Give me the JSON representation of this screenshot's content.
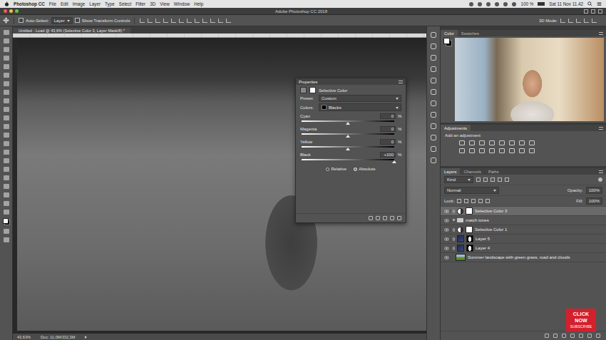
{
  "menubar": {
    "app": "Photoshop CC",
    "items": [
      "File",
      "Edit",
      "Image",
      "Layer",
      "Type",
      "Select",
      "Filter",
      "3D",
      "View",
      "Window",
      "Help"
    ],
    "battery": "100 %",
    "clock": "Sat 11 Nov 11.42"
  },
  "window": {
    "title": "Adobe Photoshop CC 2018"
  },
  "options_bar": {
    "auto_select_label": "Auto-Select:",
    "auto_select_checked": false,
    "auto_select_value": "Layer",
    "transform_label": "Show Transform Controls",
    "transform_checked": false,
    "mode_label": "3D Mode:"
  },
  "document_tab": {
    "title": "Untitled - Load @ 43,6% (Selective Color 3, Layer Mask/8) *"
  },
  "properties": {
    "title": "Properties",
    "adjustment": "Selective Color",
    "preset_label": "Preset:",
    "preset": "Custom",
    "colors_label": "Colors:",
    "colors": "Blacks",
    "sliders": [
      {
        "name": "Cyan",
        "value": "0",
        "unit": "%",
        "level": 0.5
      },
      {
        "name": "Magenta",
        "value": "0",
        "unit": "%",
        "level": 0.5
      },
      {
        "name": "Yellow",
        "value": "0",
        "unit": "%",
        "level": 0.5
      },
      {
        "name": "Black",
        "value": "+100",
        "unit": "%",
        "level": 1
      }
    ],
    "method": [
      {
        "label": "Relative",
        "selected": false
      },
      {
        "label": "Absolute",
        "selected": true
      }
    ]
  },
  "status_bar": {
    "zoom": "43,63%",
    "doc": "Doc: 11,0M/332,3M"
  },
  "color_panel": {
    "tabs": [
      {
        "label": "Color",
        "selected": true
      },
      {
        "label": "Swatches",
        "selected": false
      }
    ]
  },
  "adjustments": {
    "title": "Adjustments",
    "hint": "Add an adjustment"
  },
  "layers_panel": {
    "tabs": [
      {
        "label": "Layers",
        "selected": true
      },
      {
        "label": "Channels",
        "selected": false
      },
      {
        "label": "Paths",
        "selected": false
      }
    ],
    "filter": "Kind",
    "blend": "Normal",
    "opacity_label": "Opacity:",
    "opacity": "100%",
    "lock_label": "Lock:",
    "fill_label": "Fill:",
    "fill": "100%",
    "layers": [
      {
        "name": "Selective Color 3",
        "kind": "adjustment",
        "visible": true,
        "selected": true,
        "expanded": false
      },
      {
        "name": "match tones",
        "kind": "group",
        "visible": true,
        "selected": false,
        "expanded": true
      },
      {
        "name": "Selective Color 1",
        "kind": "adjustment",
        "visible": true,
        "selected": false,
        "expanded": false
      },
      {
        "name": "Layer 5",
        "kind": "pixel",
        "visible": true,
        "selected": false,
        "expanded": false
      },
      {
        "name": "Layer 4",
        "kind": "pixel",
        "visible": true,
        "selected": false,
        "expanded": false
      },
      {
        "name": "Summer landscape with green grass, road and clouds",
        "kind": "image",
        "visible": true,
        "selected": false,
        "expanded": false
      }
    ]
  },
  "subscribe_badge": {
    "lines": [
      "CLICK",
      "NOW",
      "SUBSCRIBE"
    ]
  }
}
